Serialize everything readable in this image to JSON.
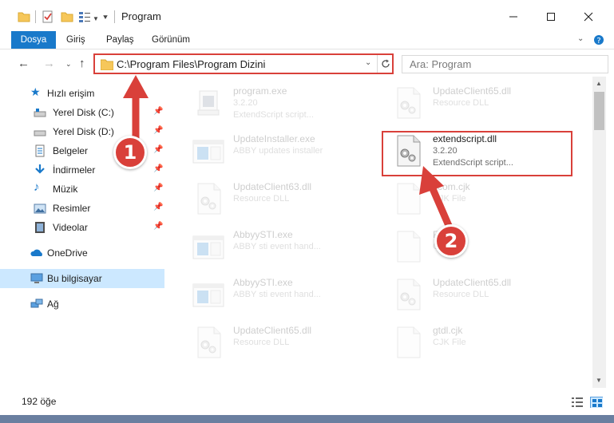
{
  "window": {
    "title": "Program",
    "controls": {
      "minimize": "minimize-icon",
      "maximize": "maximize-icon",
      "close": "close-icon"
    }
  },
  "ribbon": {
    "tabs": [
      "Dosya",
      "Giriş",
      "Paylaş",
      "Görünüm"
    ]
  },
  "address": {
    "path": "C:\\Program Files\\Program Dizini",
    "search_placeholder": "Ara: Program"
  },
  "nav": {
    "quick_access": "Hızlı erişim",
    "items": [
      {
        "label": "Yerel Disk (C:)",
        "icon": "drive-icon",
        "pinned": true
      },
      {
        "label": "Yerel Disk (D:)",
        "icon": "drive-icon",
        "pinned": true
      },
      {
        "label": "Belgeler",
        "icon": "documents-icon",
        "pinned": true
      },
      {
        "label": "İndirmeler",
        "icon": "download-icon",
        "pinned": true
      },
      {
        "label": "Müzik",
        "icon": "music-icon",
        "pinned": true
      },
      {
        "label": "Resimler",
        "icon": "pictures-icon",
        "pinned": true
      },
      {
        "label": "Videolar",
        "icon": "videos-icon",
        "pinned": true
      }
    ],
    "onedrive": "OneDrive",
    "this_pc": "Bu bilgisayar",
    "network": "Ağ"
  },
  "files": [
    {
      "name": "program.exe",
      "version": "3.2.20",
      "desc": "ExtendScript script...",
      "icon": "exe-icon",
      "faded": true
    },
    {
      "name": "UpdateClient65.dll",
      "version": "",
      "desc": "Resource DLL",
      "icon": "dll-icon",
      "faded": true
    },
    {
      "name": "UpdateInstaller.exe",
      "version": "",
      "desc": "ABBY updates installer",
      "icon": "app-icon",
      "faded": true
    },
    {
      "name": "extendscript.dll",
      "version": "3.2.20",
      "desc": "ExtendScript script...",
      "icon": "dll-icon",
      "faded": false
    },
    {
      "name": "UpdateClient63.dll",
      "version": "",
      "desc": "Resource DLL",
      "icon": "dll-icon",
      "faded": true
    },
    {
      "name": "ccom.cjk",
      "version": "",
      "desc": "CJK File",
      "icon": "file-icon",
      "faded": true
    },
    {
      "name": "AbbyySTI.exe",
      "version": "",
      "desc": "ABBY sti event hand...",
      "icon": "app-icon",
      "faded": true
    },
    {
      "name": "Fa....cjk",
      "version": "",
      "desc": "CJK File",
      "icon": "file-icon",
      "faded": true
    },
    {
      "name": "AbbyySTI.exe",
      "version": "",
      "desc": "ABBY sti event hand...",
      "icon": "app-icon",
      "faded": true
    },
    {
      "name": "UpdateClient65.dll",
      "version": "",
      "desc": "Resource DLL",
      "icon": "dll-icon",
      "faded": true
    },
    {
      "name": "UpdateClient65.dll",
      "version": "",
      "desc": "Resource DLL",
      "icon": "dll-icon",
      "faded": true
    },
    {
      "name": "gtdl.cjk",
      "version": "",
      "desc": "CJK File",
      "icon": "file-icon",
      "faded": true
    }
  ],
  "status": {
    "count": "192 öğe"
  },
  "annotations": {
    "step1": "1",
    "step2": "2",
    "accent": "#d9403a"
  }
}
